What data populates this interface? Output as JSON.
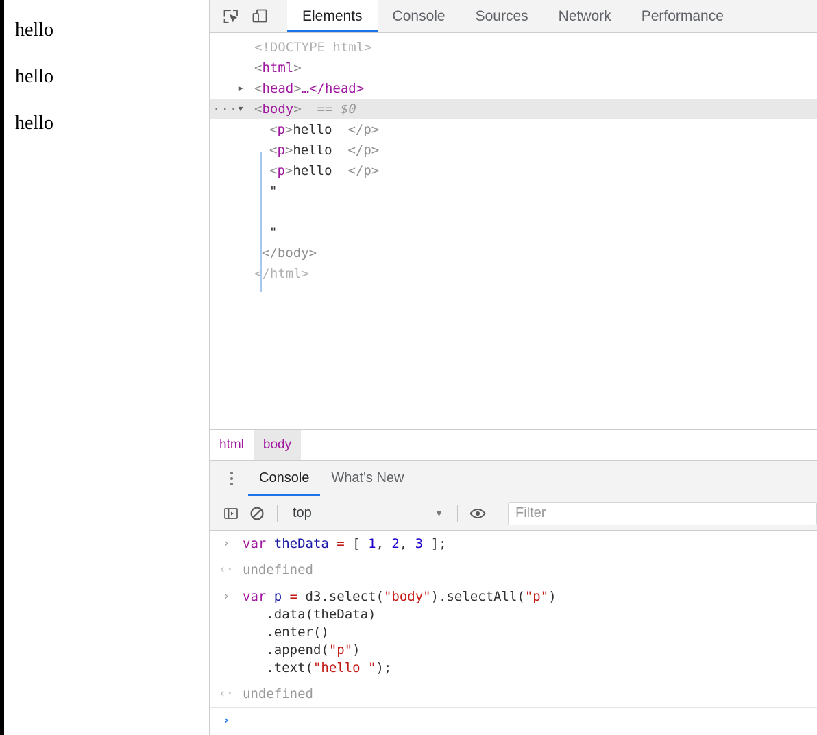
{
  "page": {
    "paragraphs": [
      "hello",
      "hello",
      "hello"
    ]
  },
  "devtools": {
    "toolbar": {
      "inspect_icon": "inspect-element-icon",
      "device_icon": "device-toolbar-icon"
    },
    "tabs": [
      {
        "label": "Elements",
        "active": true
      },
      {
        "label": "Console",
        "active": false
      },
      {
        "label": "Sources",
        "active": false
      },
      {
        "label": "Network",
        "active": false
      },
      {
        "label": "Performance",
        "active": false
      }
    ],
    "dom_tree": [
      {
        "id": "doctype",
        "indent": 1,
        "marker": "",
        "twisty": "",
        "doctype": "<!DOCTYPE html>"
      },
      {
        "id": "html-open",
        "indent": 1,
        "marker": "",
        "twisty": "",
        "open": "<",
        "tag": "html",
        "close": ">"
      },
      {
        "id": "head",
        "indent": 1,
        "marker": "",
        "twisty": "▶",
        "open": "<",
        "tag": "head",
        "close": ">",
        "collapsed": "…</head>"
      },
      {
        "id": "body-open",
        "indent": 1,
        "marker": "···",
        "twisty": "▼",
        "open": "<",
        "tag": "body",
        "close": ">",
        "meta": "== $0",
        "selected": true
      },
      {
        "id": "p1",
        "indent": 3,
        "marker": "",
        "twisty": "",
        "open": "<",
        "tag": "p",
        "close": ">",
        "text": "hello ",
        "endtag": "</p>"
      },
      {
        "id": "p2",
        "indent": 3,
        "marker": "",
        "twisty": "",
        "open": "<",
        "tag": "p",
        "close": ">",
        "text": "hello ",
        "endtag": "</p>"
      },
      {
        "id": "p3",
        "indent": 3,
        "marker": "",
        "twisty": "",
        "open": "<",
        "tag": "p",
        "close": ">",
        "text": "hello ",
        "endtag": "</p>"
      },
      {
        "id": "textnode-open",
        "indent": 3,
        "marker": "",
        "twisty": "",
        "text": "\""
      },
      {
        "id": "textnode-blank",
        "indent": 3,
        "marker": "",
        "twisty": "",
        "text": ""
      },
      {
        "id": "textnode-close",
        "indent": 3,
        "marker": "",
        "twisty": "",
        "text": "\""
      },
      {
        "id": "body-close",
        "indent": 2,
        "marker": "",
        "twisty": "",
        "endtag": "</body>"
      },
      {
        "id": "html-close",
        "indent": 1,
        "marker": "",
        "twisty": "",
        "doctype": "</html>"
      }
    ],
    "breadcrumb": [
      {
        "label": "html",
        "selected": false
      },
      {
        "label": "body",
        "selected": true
      }
    ],
    "drawer": {
      "kebab_icon": "more-options-icon",
      "tabs": [
        {
          "label": "Console",
          "active": true
        },
        {
          "label": "What's New",
          "active": false
        }
      ],
      "toolbar": {
        "sidebar_icon": "console-sidebar-icon",
        "clear_icon": "clear-console-icon",
        "context": "top",
        "caret_icon": "chevron-down-icon",
        "eye_icon": "live-expression-eye-icon",
        "filter_placeholder": "Filter"
      },
      "messages": [
        {
          "id": "msg-1",
          "kind": "input",
          "gutter": "›",
          "lines": [
            [
              {
                "t": "var ",
                "c": "k-kw"
              },
              {
                "t": "theData ",
                "c": "k-var"
              },
              {
                "t": "= ",
                "c": "k-op"
              },
              {
                "t": "[ ",
                "c": "k-plain"
              },
              {
                "t": "1",
                "c": "k-num"
              },
              {
                "t": ", ",
                "c": "k-plain"
              },
              {
                "t": "2",
                "c": "k-num"
              },
              {
                "t": ", ",
                "c": "k-plain"
              },
              {
                "t": "3",
                "c": "k-num"
              },
              {
                "t": " ];",
                "c": "k-plain"
              }
            ]
          ]
        },
        {
          "id": "msg-2",
          "kind": "result",
          "gutter": "‹·",
          "lines": [
            [
              {
                "t": "undefined",
                "c": "k-undef"
              }
            ]
          ]
        },
        {
          "id": "msg-3",
          "kind": "input",
          "separator": true,
          "gutter": "›",
          "lines": [
            [
              {
                "t": "var ",
                "c": "k-kw"
              },
              {
                "t": "p ",
                "c": "k-var"
              },
              {
                "t": "= ",
                "c": "k-op"
              },
              {
                "t": "d3.select(",
                "c": "k-plain"
              },
              {
                "t": "\"body\"",
                "c": "k-str"
              },
              {
                "t": ").selectAll(",
                "c": "k-plain"
              },
              {
                "t": "\"p\"",
                "c": "k-str"
              },
              {
                "t": ")",
                "c": "k-plain"
              }
            ],
            [
              {
                "t": "   .data(theData)",
                "c": "k-plain"
              }
            ],
            [
              {
                "t": "   .enter()",
                "c": "k-plain"
              }
            ],
            [
              {
                "t": "   .append(",
                "c": "k-plain"
              },
              {
                "t": "\"p\"",
                "c": "k-str"
              },
              {
                "t": ")",
                "c": "k-plain"
              }
            ],
            [
              {
                "t": "   .text(",
                "c": "k-plain"
              },
              {
                "t": "\"hello \"",
                "c": "k-str"
              },
              {
                "t": ");",
                "c": "k-plain"
              }
            ]
          ]
        },
        {
          "id": "msg-4",
          "kind": "result",
          "gutter": "‹·",
          "lines": [
            [
              {
                "t": "undefined",
                "c": "k-undef"
              }
            ]
          ]
        },
        {
          "id": "msg-5",
          "kind": "prompt",
          "separator": true,
          "gutter": "›",
          "lines": [
            []
          ]
        }
      ]
    }
  }
}
